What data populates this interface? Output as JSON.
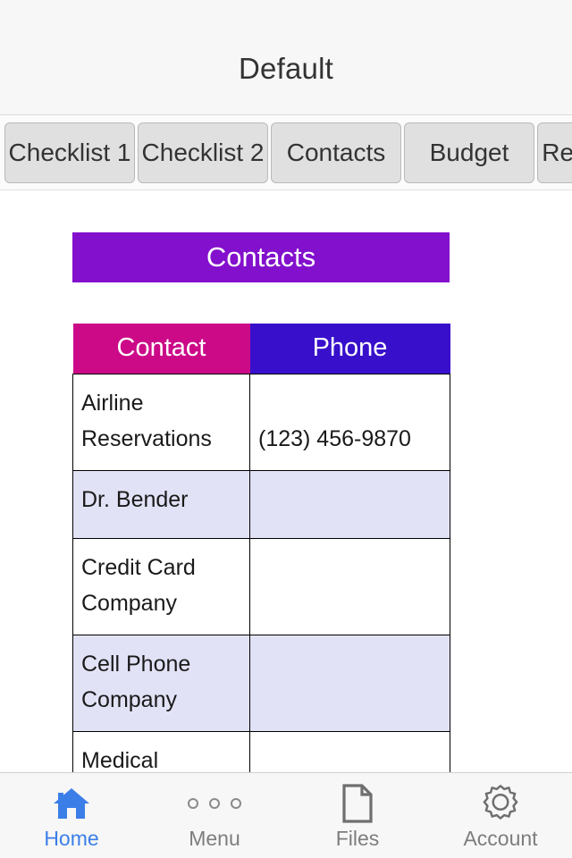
{
  "header": {
    "title": "Default"
  },
  "tabs": [
    {
      "label": "Checklist 1",
      "active": false
    },
    {
      "label": "Checklist 2",
      "active": false
    },
    {
      "label": "Contacts",
      "active": true
    },
    {
      "label": "Budget",
      "active": false
    },
    {
      "label": "Reminders",
      "active": false
    }
  ],
  "section": {
    "banner_label": "Contacts",
    "banner_color": "#8310cc"
  },
  "table": {
    "columns": [
      {
        "label": "Contact",
        "color": "#cc0a88"
      },
      {
        "label": "Phone",
        "color": "#3810cc"
      }
    ],
    "rows": [
      {
        "contact": "Airline Reservations",
        "phone": "(123) 456-9870"
      },
      {
        "contact": "Dr. Bender",
        "phone": ""
      },
      {
        "contact": "Credit Card Company",
        "phone": ""
      },
      {
        "contact": "Cell Phone Company",
        "phone": ""
      },
      {
        "contact": "Medical Insurance",
        "phone": ""
      }
    ],
    "alt_row_color": "#e2e2f7"
  },
  "bottom_nav": {
    "active_color": "#3b7ee8",
    "inactive_color": "#7d7d7d",
    "items": [
      {
        "label": "Home",
        "icon": "home-icon",
        "active": true
      },
      {
        "label": "Menu",
        "icon": "menu-dots-icon",
        "active": false
      },
      {
        "label": "Files",
        "icon": "file-icon",
        "active": false
      },
      {
        "label": "Account",
        "icon": "gear-icon",
        "active": false
      }
    ]
  }
}
